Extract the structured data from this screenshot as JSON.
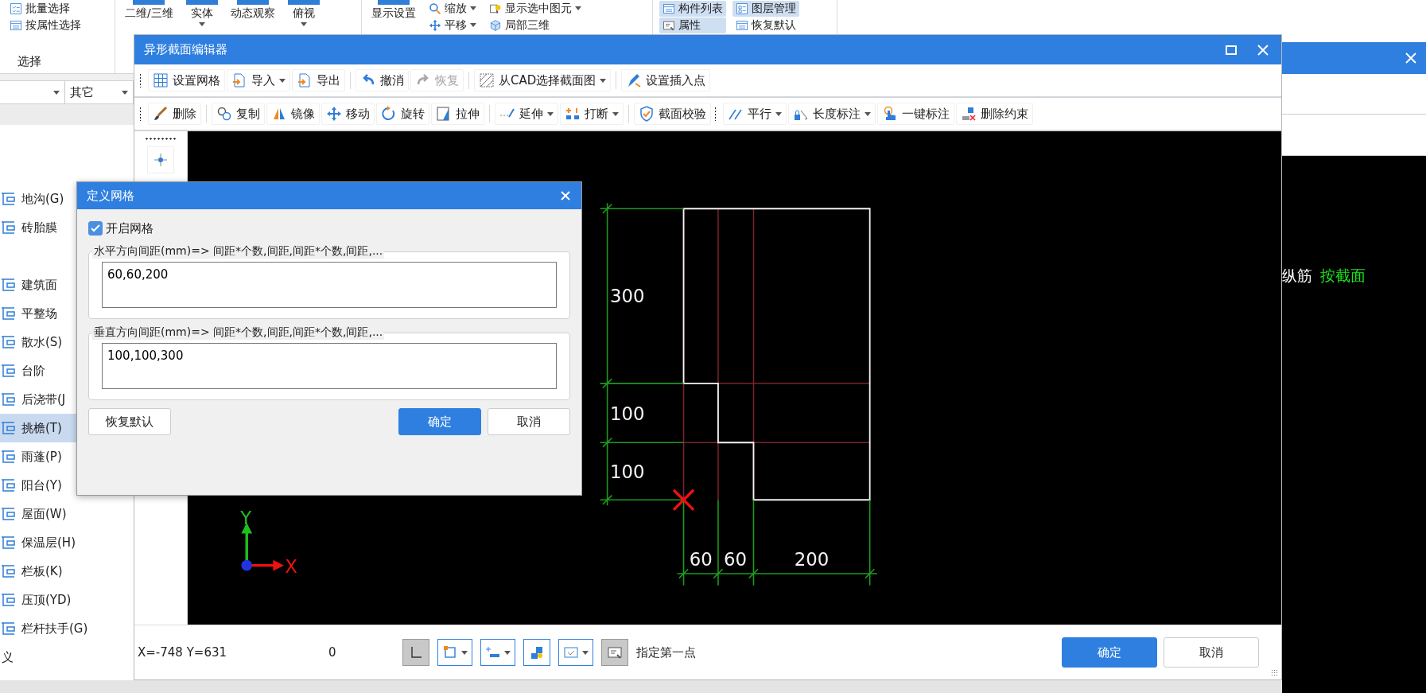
{
  "ribbon": {
    "groups": [
      {
        "label": "选择",
        "items": [
          {
            "label": "批量选择",
            "kind": "small",
            "dropdown": false,
            "highlighted": false
          },
          {
            "label": "按属性选择",
            "kind": "small",
            "dropdown": false,
            "highlighted": false
          }
        ]
      },
      {
        "items": [
          {
            "label": "二维/三维",
            "kind": "large",
            "dropdown": false,
            "highlighted": false
          },
          {
            "label": "实体",
            "kind": "large",
            "dropdown": true,
            "highlighted": false
          },
          {
            "label": "动态观察",
            "kind": "large",
            "dropdown": false,
            "highlighted": false
          },
          {
            "label": "俯视",
            "kind": "large",
            "dropdown": true,
            "highlighted": false
          }
        ]
      },
      {
        "items": [
          {
            "label": "显示设置",
            "kind": "large",
            "dropdown": false,
            "highlighted": false
          },
          {
            "label": "缩放",
            "kind": "small",
            "dropdown": true,
            "highlighted": false
          },
          {
            "label": "平移",
            "kind": "small",
            "dropdown": true,
            "highlighted": false
          },
          {
            "label": "显示选中图元",
            "kind": "small",
            "dropdown": true,
            "highlighted": false
          },
          {
            "label": "局部三维",
            "kind": "small",
            "dropdown": false,
            "highlighted": false
          }
        ]
      },
      {
        "items": [
          {
            "label": "构件列表",
            "kind": "small",
            "dropdown": false,
            "highlighted": true
          },
          {
            "label": "属性",
            "kind": "small",
            "dropdown": false,
            "highlighted": true
          },
          {
            "label": "图层管理",
            "kind": "small",
            "dropdown": false,
            "highlighted": true
          },
          {
            "label": "恢复默认",
            "kind": "small",
            "dropdown": false,
            "highlighted": false
          }
        ]
      }
    ]
  },
  "filter_bar": {
    "dropdowns": [
      {
        "kind": "empty"
      },
      {
        "kind": "value",
        "value": "其它"
      }
    ]
  },
  "sidebar": {
    "items": [
      {
        "label": "地沟(G)",
        "kind": "component",
        "selected": false,
        "gap_before": false
      },
      {
        "label": "砖胎膜",
        "kind": "component",
        "selected": false,
        "gap_before": false
      },
      {
        "label": "建筑面",
        "kind": "component",
        "selected": false,
        "gap_before": true
      },
      {
        "label": "平整场",
        "kind": "component",
        "selected": false,
        "gap_before": false
      },
      {
        "label": "散水(S)",
        "kind": "component",
        "selected": false,
        "gap_before": false
      },
      {
        "label": "台阶",
        "kind": "component",
        "selected": false,
        "gap_before": false
      },
      {
        "label": "后浇带(J",
        "kind": "component",
        "selected": false,
        "gap_before": false
      },
      {
        "label": "挑檐(T)",
        "kind": "component",
        "selected": true,
        "gap_before": false
      },
      {
        "label": "雨蓬(P)",
        "kind": "component",
        "selected": false,
        "gap_before": false
      },
      {
        "label": "阳台(Y)",
        "kind": "component",
        "selected": false,
        "gap_before": false
      },
      {
        "label": "屋面(W)",
        "kind": "component",
        "selected": false,
        "gap_before": false
      },
      {
        "label": "保温层(H)",
        "kind": "component",
        "selected": false,
        "gap_before": false
      },
      {
        "label": "栏板(K)",
        "kind": "component",
        "selected": false,
        "gap_before": false
      },
      {
        "label": "压顶(YD)",
        "kind": "component",
        "selected": false,
        "gap_before": false
      },
      {
        "label": "栏杆扶手(G)",
        "kind": "component",
        "selected": false,
        "gap_before": false
      },
      {
        "label": "义",
        "kind": "text",
        "selected": false,
        "gap_before": false
      }
    ]
  },
  "editor": {
    "title": "异形截面编辑器",
    "toolbars": [
      [
        {
          "kind": "grip"
        },
        {
          "kind": "button",
          "label": "设置网格",
          "disabled": false
        },
        {
          "kind": "dropdown",
          "label": "导入",
          "disabled": false
        },
        {
          "kind": "button",
          "label": "导出",
          "disabled": false
        },
        {
          "kind": "separator"
        },
        {
          "kind": "button",
          "label": "撤消",
          "disabled": false
        },
        {
          "kind": "button",
          "label": "恢复",
          "disabled": true
        },
        {
          "kind": "separator"
        },
        {
          "kind": "dropdown",
          "label": "从CAD选择截面图",
          "disabled": false
        },
        {
          "kind": "separator"
        },
        {
          "kind": "button",
          "label": "设置插入点",
          "disabled": false
        }
      ],
      [
        {
          "kind": "grip"
        },
        {
          "kind": "button",
          "label": "删除",
          "disabled": false
        },
        {
          "kind": "separator"
        },
        {
          "kind": "button",
          "label": "复制",
          "disabled": false
        },
        {
          "kind": "button",
          "label": "镜像",
          "disabled": false
        },
        {
          "kind": "button",
          "label": "移动",
          "disabled": false
        },
        {
          "kind": "button",
          "label": "旋转",
          "disabled": false
        },
        {
          "kind": "button",
          "label": "拉伸",
          "disabled": false
        },
        {
          "kind": "separator"
        },
        {
          "kind": "dropdown",
          "label": "延伸",
          "disabled": false
        },
        {
          "kind": "dropdown",
          "label": "打断",
          "disabled": false
        },
        {
          "kind": "separator"
        },
        {
          "kind": "button",
          "label": "截面校验",
          "disabled": false
        },
        {
          "kind": "grip"
        },
        {
          "kind": "dropdown",
          "label": "平行",
          "disabled": false
        },
        {
          "kind": "dropdown",
          "label": "长度标注",
          "disabled": false
        },
        {
          "kind": "button",
          "label": "一键标注",
          "disabled": false
        },
        {
          "kind": "button",
          "label": "删除约束",
          "disabled": false
        }
      ]
    ],
    "canvas": {
      "vertical_dimensions": [
        "300",
        "100",
        "100"
      ],
      "horizontal_dimensions": [
        "60",
        "60",
        "200"
      ],
      "axis": {
        "x_label": "X",
        "y_label": "Y"
      }
    },
    "status": {
      "coordinates": "X=-748 Y=631",
      "value": "0",
      "tools": [
        {
          "kind": "toggle",
          "pressed": true
        },
        {
          "kind": "dropdown"
        },
        {
          "kind": "dropdown"
        },
        {
          "kind": "button"
        },
        {
          "kind": "dropdown"
        },
        {
          "kind": "toggle",
          "pressed": true
        }
      ],
      "prompt": "指定第一点"
    },
    "buttons": [
      {
        "label": "确定",
        "kind": "primary"
      },
      {
        "label": "取消",
        "kind": "secondary"
      }
    ]
  },
  "grid_dialog": {
    "title": "定义网格",
    "enable_grid": {
      "label": "开启网格",
      "checked": true
    },
    "groups": [
      {
        "legend": "水平方向间距(mm)=> 间距*个数,间距,间距*个数,间距,...",
        "value": "60,60,200"
      },
      {
        "legend": "垂直方向间距(mm)=> 间距*个数,间距,间距*个数,间距,...",
        "value": "100,100,300"
      }
    ],
    "buttons": [
      {
        "label": "恢复默认",
        "kind": "secondary"
      },
      {
        "label": "确定",
        "kind": "primary"
      },
      {
        "label": "取消",
        "kind": "secondary"
      }
    ]
  },
  "right_window": {
    "canvas_texts": [
      {
        "text": "纵筋",
        "color": "#ffffff"
      },
      {
        "text": "按截面",
        "color": "#19e619"
      }
    ]
  }
}
